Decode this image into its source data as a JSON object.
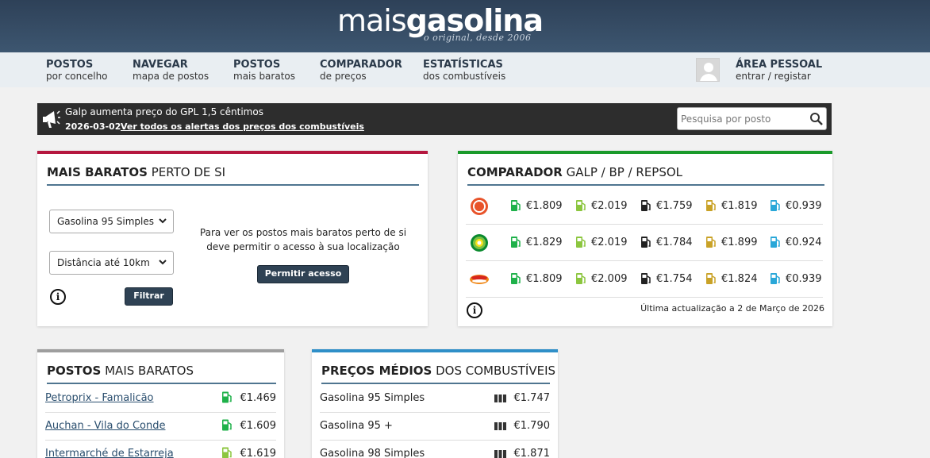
{
  "header": {
    "logo_light": "mais",
    "logo_bold": "gasolina",
    "tagline": "o original, desde 2006"
  },
  "nav": {
    "items": [
      {
        "title": "POSTOS",
        "subtitle": "por concelho"
      },
      {
        "title": "NAVEGAR",
        "subtitle": "mapa de postos"
      },
      {
        "title": "POSTOS",
        "subtitle": "mais baratos"
      },
      {
        "title": "COMPARADOR",
        "subtitle": "de preços"
      },
      {
        "title": "ESTATÍSTICAS",
        "subtitle": "dos combustíveis"
      }
    ],
    "account": {
      "title": "ÁREA PESSOAL",
      "subtitle": "entrar / registar"
    }
  },
  "alert": {
    "message": "Galp aumenta preço do GPL 1,5 cêntimos",
    "date": "2026-03-02",
    "link": "Ver todos os alertas dos preços dos combustíveis"
  },
  "search": {
    "placeholder": "Pesquisa por posto"
  },
  "nearby": {
    "title_bold": "MAIS BARATOS",
    "title_rest": " PERTO DE SI",
    "fuel_select": "Gasolina 95 Simples",
    "distance_select": "Distância até 10km",
    "filter_button": "Filtrar",
    "location_message": "Para ver os postos mais baratos perto de si deve permitir o acesso à sua localização",
    "allow_button": "Permitir acesso",
    "info": "i"
  },
  "comparador": {
    "title_bold": "COMPARADOR",
    "title_rest": " GALP / BP / REPSOL",
    "rows": [
      {
        "brand": "galp-logo",
        "prices": [
          "€1.809",
          "€2.019",
          "€1.759",
          "€1.819",
          "€0.939"
        ]
      },
      {
        "brand": "bp-logo",
        "prices": [
          "€1.829",
          "€2.019",
          "€1.784",
          "€1.899",
          "€0.924"
        ]
      },
      {
        "brand": "repsol-logo",
        "prices": [
          "€1.809",
          "€2.009",
          "€1.754",
          "€1.824",
          "€0.939"
        ]
      }
    ],
    "pump_colors": [
      "#1fb14a",
      "#8cc63f",
      "#222222",
      "#c9a227",
      "#29a7d8"
    ],
    "updated": "Última actualização a 2 de Março de 2026",
    "info": "i"
  },
  "cheapest": {
    "title_bold": "POSTOS",
    "title_rest": " MAIS BARATOS",
    "rows": [
      {
        "name": "Petroprix - Famalicão",
        "price": "€1.469",
        "pump_color": "#1fb14a"
      },
      {
        "name": "Auchan - Vila do Conde",
        "price": "€1.609",
        "pump_color": "#1fb14a"
      },
      {
        "name": "Intermarché de Estarreja",
        "price": "€1.619",
        "pump_color": "#8cc63f"
      }
    ]
  },
  "averages": {
    "title_bold": "PREÇOS MÉDIOS",
    "title_rest": " DOS COMBUSTÍVEIS",
    "rows": [
      {
        "name": "Gasolina 95 Simples",
        "price": "€1.747"
      },
      {
        "name": "Gasolina 95 +",
        "price": "€1.790"
      },
      {
        "name": "Gasolina 98 Simples",
        "price": "€1.871"
      }
    ]
  },
  "colors": {
    "accent_red": "#b5173f",
    "accent_green": "#1a9a2a",
    "accent_gray": "#9e9e9e",
    "accent_blue": "#2f8fc8",
    "header_blue": "#2e4158"
  }
}
